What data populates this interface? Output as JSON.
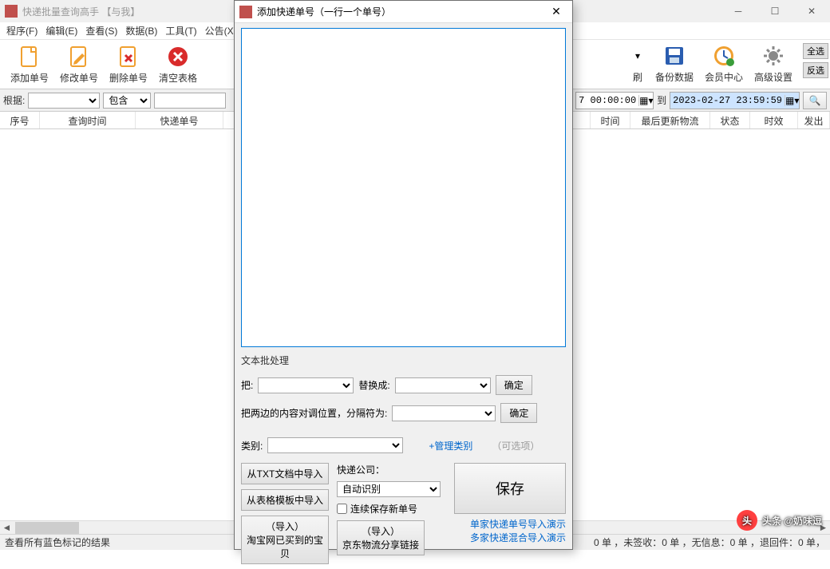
{
  "main": {
    "title": "快递批量查询高手 【与我】",
    "menus": [
      "程序(F)",
      "编辑(E)",
      "查看(S)",
      "数据(B)",
      "工具(T)",
      "公告(X)"
    ],
    "toolbar_left": [
      {
        "label": "添加单号",
        "icon": "page-add-icon"
      },
      {
        "label": "修改单号",
        "icon": "page-edit-icon"
      },
      {
        "label": "删除单号",
        "icon": "page-delete-icon"
      },
      {
        "label": "清空表格",
        "icon": "clear-icon"
      }
    ],
    "toolbar_right": [
      {
        "label": "刷",
        "icon": "refresh-icon"
      },
      {
        "label": "备份数据",
        "icon": "save-icon"
      },
      {
        "label": "会员中心",
        "icon": "member-icon"
      },
      {
        "label": "高级设置",
        "icon": "settings-icon"
      }
    ],
    "side_buttons": {
      "select_all": "全选",
      "invert": "反选"
    },
    "filter": {
      "root_label": "根据:",
      "contains_label": "包含",
      "date_from": "7 00:00:00",
      "date_to_label": "到",
      "date_to": "2023-02-27 23:59:59"
    },
    "columns": [
      "序号",
      "查询时间",
      "快递单号",
      "时间",
      "最后更新物流",
      "状态",
      "时效",
      "发出"
    ],
    "status_left": "查看所有蓝色标记的结果",
    "status_right": "0 单 ，未签收：0 单 ，无信息：0 单 ，退回件：0 单，"
  },
  "dialog": {
    "title": "添加快递单号（一行一个单号）",
    "textarea_value": "",
    "text_batch_label": "文本批处理",
    "replace_from_label": "把:",
    "replace_to_label": "替换成:",
    "swap_label": "把两边的内容对调位置，分隔符为:",
    "ok_btn": "确定",
    "category_label": "类别:",
    "manage_category": "+管理类别",
    "optional": "（可选项）",
    "import_txt": "从TXT文档中导入",
    "import_template": "从表格模板中导入",
    "courier_label": "快递公司：",
    "courier_value": "自动识别",
    "continuous_save": "连续保存新单号",
    "save_btn": "保存",
    "import_label": "（导入）",
    "taobao_btn": "淘宝网已买到的宝贝",
    "jd_btn": "京东物流分享链接",
    "demo_single": "单家快递单号导入演示",
    "demo_multi": "多家快递混合导入演示"
  },
  "watermark": "头条 @奶味逗"
}
